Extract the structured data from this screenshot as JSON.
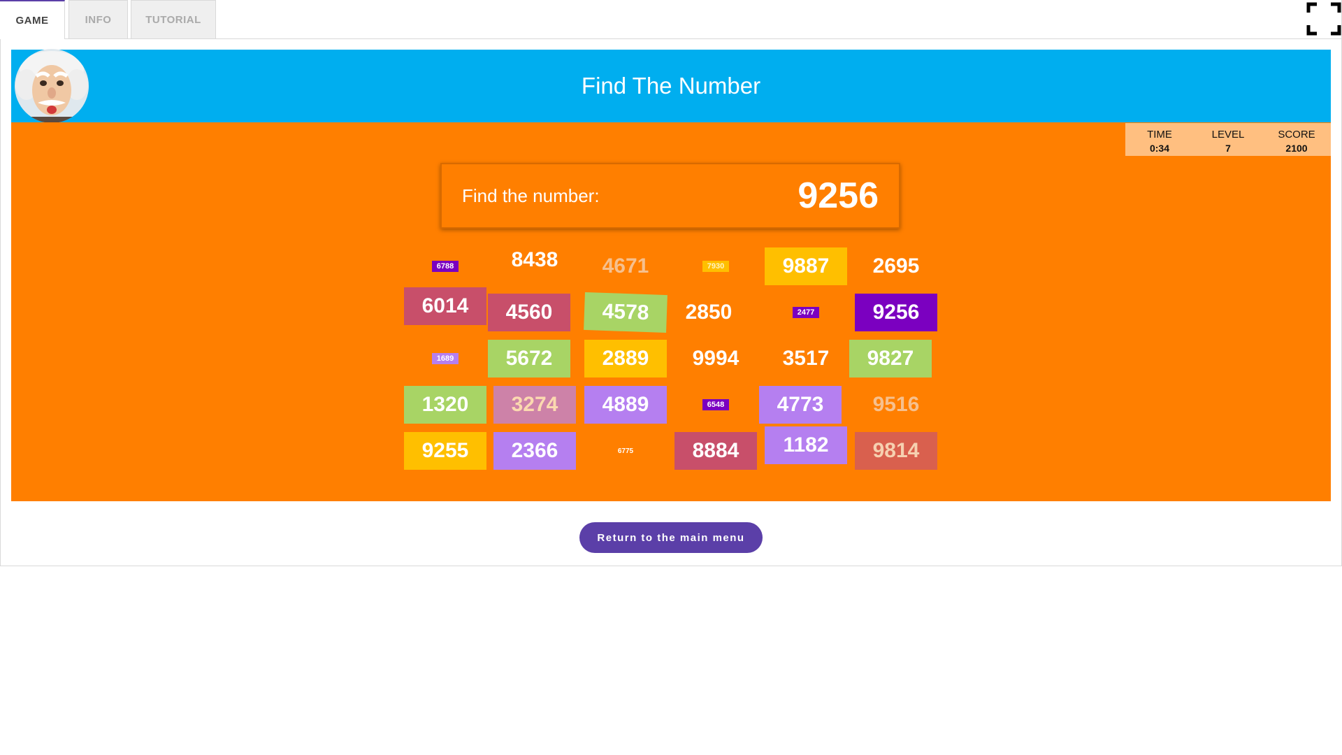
{
  "tabs": [
    {
      "label": "GAME",
      "active": true
    },
    {
      "label": "INFO",
      "active": false
    },
    {
      "label": "TUTORIAL",
      "active": false
    }
  ],
  "header": {
    "title": "Find The Number",
    "background": "#00aeef"
  },
  "stats": {
    "time_label": "TIME",
    "time_value": "0:34",
    "level_label": "LEVEL",
    "level_value": "7",
    "score_label": "SCORE",
    "score_value": "2100"
  },
  "target": {
    "prompt": "Find the number:",
    "number": "9256"
  },
  "board": {
    "background": "#ff7f00",
    "tiles": [
      {
        "value": "6788",
        "bg": "#7b00c0",
        "color": "#ffffff",
        "size": "sm"
      },
      {
        "value": "8438",
        "bg": "transparent",
        "color": "#ffffff",
        "size": "lg"
      },
      {
        "value": "4671",
        "bg": "transparent",
        "color": "#f6c08e",
        "size": "lg"
      },
      {
        "value": "7930",
        "bg": "#ffbf00",
        "color": "#fff3c4",
        "size": "sm"
      },
      {
        "value": "9887",
        "bg": "#ffbf00",
        "color": "#ffffff",
        "size": "lg"
      },
      {
        "value": "2695",
        "bg": "transparent",
        "color": "#ffffff",
        "size": "lg"
      },
      {
        "value": "6014",
        "bg": "#c84f6a",
        "color": "#ffffff",
        "size": "lg"
      },
      {
        "value": "4560",
        "bg": "#c84f6a",
        "color": "#ffffff",
        "size": "lg"
      },
      {
        "value": "4578",
        "bg": "#a8d465",
        "color": "#ffffff",
        "size": "lg"
      },
      {
        "value": "2850",
        "bg": "transparent",
        "color": "#ffffff",
        "size": "lg"
      },
      {
        "value": "2477",
        "bg": "#7b00c0",
        "color": "#ffffff",
        "size": "sm"
      },
      {
        "value": "9256",
        "bg": "#7b00c0",
        "color": "#ffffff",
        "size": "lg"
      },
      {
        "value": "1689",
        "bg": "#b57ff0",
        "color": "#ffffff",
        "size": "sm"
      },
      {
        "value": "5672",
        "bg": "#a8d465",
        "color": "#ffffff",
        "size": "lg"
      },
      {
        "value": "2889",
        "bg": "#ffbf00",
        "color": "#ffffff",
        "size": "lg"
      },
      {
        "value": "9994",
        "bg": "transparent",
        "color": "#ffffff",
        "size": "lg"
      },
      {
        "value": "3517",
        "bg": "transparent",
        "color": "#ffffff",
        "size": "lg"
      },
      {
        "value": "9827",
        "bg": "#a8d465",
        "color": "#ffffff",
        "size": "lg"
      },
      {
        "value": "1320",
        "bg": "#a8d465",
        "color": "#ffffff",
        "size": "lg"
      },
      {
        "value": "3274",
        "bg": "#cd82a8",
        "color": "#fbd9b0",
        "size": "lg"
      },
      {
        "value": "4889",
        "bg": "#b57ff0",
        "color": "#ffffff",
        "size": "lg"
      },
      {
        "value": "6548",
        "bg": "#7b00c0",
        "color": "#ffffff",
        "size": "sm"
      },
      {
        "value": "4773",
        "bg": "#b57ff0",
        "color": "#ffffff",
        "size": "lg"
      },
      {
        "value": "9516",
        "bg": "transparent",
        "color": "#f6c08e",
        "size": "lg"
      },
      {
        "value": "9255",
        "bg": "#ffbf00",
        "color": "#ffffff",
        "size": "lg"
      },
      {
        "value": "2366",
        "bg": "#b57ff0",
        "color": "#ffffff",
        "size": "lg"
      },
      {
        "value": "6775",
        "bg": "transparent",
        "color": "#ffffff",
        "size": "xs"
      },
      {
        "value": "8884",
        "bg": "#c84f6a",
        "color": "#ffffff",
        "size": "lg"
      },
      {
        "value": "1182",
        "bg": "#b57ff0",
        "color": "#ffffff",
        "size": "lg"
      },
      {
        "value": "9814",
        "bg": "#d9604e",
        "color": "#f6d0b0",
        "size": "lg"
      }
    ]
  },
  "menu_button": {
    "label": "Return to the main menu"
  },
  "icons": {
    "fullscreen": "fullscreen-icon",
    "avatar": "einstein-avatar"
  }
}
